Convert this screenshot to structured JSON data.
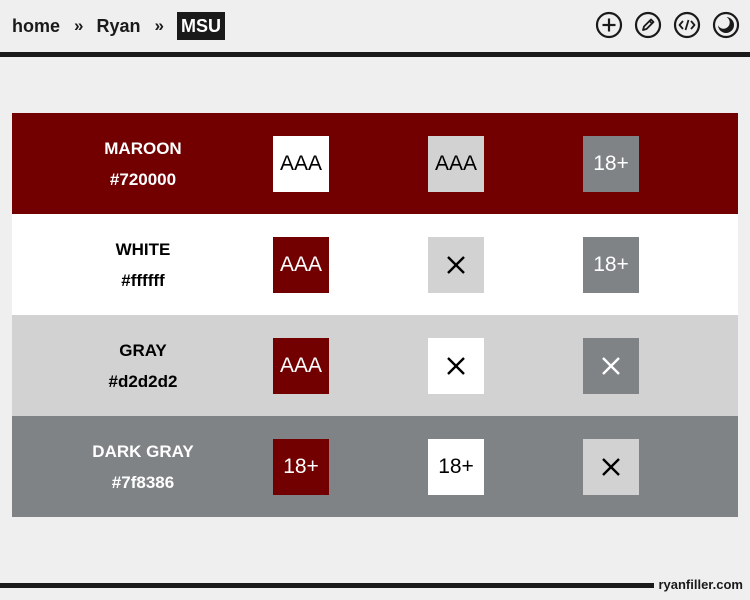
{
  "breadcrumb": {
    "home": "home",
    "sep1": "»",
    "parent": "Ryan",
    "sep2": "»",
    "current": "MSU"
  },
  "header_icons": [
    "add-icon",
    "edit-pencil-icon",
    "code-icon",
    "theme-toggle-icon"
  ],
  "colors": {
    "maroon": "#720000",
    "white": "#ffffff",
    "gray": "#d2d2d2",
    "dark_gray": "#7f8386",
    "black": "#000000"
  },
  "rows": [
    {
      "name": "MAROON",
      "hex": "#720000",
      "bg": "#720000",
      "fg": "#ffffff",
      "cells": [
        {
          "label": "AAA",
          "bg": "#ffffff",
          "fg": "#000000"
        },
        {
          "label": "AAA",
          "bg": "#d2d2d2",
          "fg": "#000000"
        },
        {
          "label": "18+",
          "bg": "#7f8386",
          "fg": "#ffffff"
        }
      ]
    },
    {
      "name": "WHITE",
      "hex": "#ffffff",
      "bg": "#ffffff",
      "fg": "#000000",
      "cells": [
        {
          "label": "AAA",
          "bg": "#720000",
          "fg": "#ffffff"
        },
        {
          "label": "",
          "icon": "close-icon",
          "bg": "#d2d2d2",
          "fg": "#000000"
        },
        {
          "label": "18+",
          "bg": "#7f8386",
          "fg": "#ffffff"
        }
      ]
    },
    {
      "name": "GRAY",
      "hex": "#d2d2d2",
      "bg": "#d2d2d2",
      "fg": "#000000",
      "cells": [
        {
          "label": "AAA",
          "bg": "#720000",
          "fg": "#ffffff"
        },
        {
          "label": "",
          "icon": "close-icon",
          "bg": "#ffffff",
          "fg": "#000000"
        },
        {
          "label": "",
          "icon": "close-icon",
          "bg": "#7f8386",
          "fg": "#ffffff"
        }
      ]
    },
    {
      "name": "DARK GRAY",
      "hex": "#7f8386",
      "bg": "#7f8386",
      "fg": "#ffffff",
      "cells": [
        {
          "label": "18+",
          "bg": "#720000",
          "fg": "#ffffff"
        },
        {
          "label": "18+",
          "bg": "#ffffff",
          "fg": "#000000"
        },
        {
          "label": "",
          "icon": "close-icon",
          "bg": "#d2d2d2",
          "fg": "#000000"
        }
      ]
    }
  ],
  "footer": {
    "brand": "ryanfiller.com"
  }
}
